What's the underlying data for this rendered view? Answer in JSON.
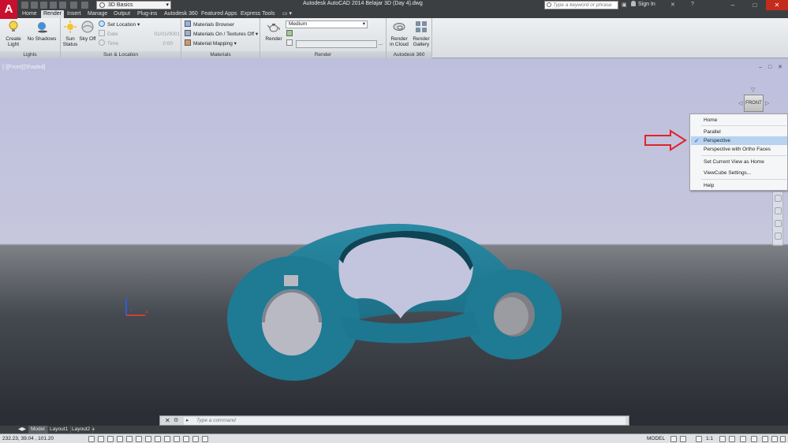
{
  "app": {
    "window_title": "Autodesk AutoCAD 2014   Belajar 3D (Day 4).dwg",
    "workspace": "3D Basics",
    "search_placeholder": "Type a keyword or phrase",
    "sign_in": "Sign In",
    "logo_letter": "A",
    "window_controls": [
      "–",
      "□",
      "✕"
    ]
  },
  "ribbon_tabs": [
    "Home",
    "Render",
    "Insert",
    "Manage",
    "Output",
    "Plug-ins",
    "Autodesk 360",
    "Featured Apps",
    "Express Tools"
  ],
  "active_tab": "Render",
  "ribbon": {
    "lights": {
      "title": "Lights",
      "create_light": "Create Light",
      "no_shadows": "No Shadows"
    },
    "sun_location": {
      "title": "Sun & Location",
      "sun_status": "Sun Status",
      "sky_off": "Sky Off",
      "set_location": "Set Location",
      "date_label": "Date",
      "date_value": "01/01/0001",
      "time_label": "Time",
      "time_value": "0:00"
    },
    "materials": {
      "title": "Materials",
      "browser": "Materials Browser",
      "on_textures_off": "Materials On / Textures Off",
      "mapping": "Material Mapping"
    },
    "render": {
      "title": "Render",
      "render_btn": "Render",
      "preset": "Medium",
      "path_button": "..."
    },
    "autodesk360": {
      "title": "Autodesk 360",
      "render_in_cloud": "Render in Cloud",
      "render_gallery": "Render Gallery"
    }
  },
  "viewport": {
    "label": "[-][Front][Shaded]",
    "controls": "– □ ✕",
    "viewcube_face": "FRONT"
  },
  "view_menu": {
    "items": [
      {
        "label": "Home",
        "checked": false
      },
      {
        "label": "Parallel",
        "checked": false
      },
      {
        "label": "Perspective",
        "checked": true
      },
      {
        "label": "Perspective with Ortho Faces",
        "checked": false
      },
      {
        "label": "Set Current View as Home",
        "checked": false
      },
      {
        "label": "ViewCube Settings...",
        "checked": false
      },
      {
        "label": "Help",
        "checked": false
      }
    ]
  },
  "ucs": {
    "y": "Y",
    "x": "X"
  },
  "command_line": {
    "placeholder": "Type  a  command",
    "close": "✕"
  },
  "layout_tabs": [
    "Model",
    "Layout1",
    "Layout2"
  ],
  "add_layout": "+",
  "status": {
    "coords": "232.23, 39.04 , 101.20",
    "model": "MODEL",
    "scale": "1:1"
  },
  "colors": {
    "model_fill": "#1f7a93",
    "model_dark": "#155a6e",
    "arrow": "#e0242a",
    "accent": "#c8102e"
  }
}
